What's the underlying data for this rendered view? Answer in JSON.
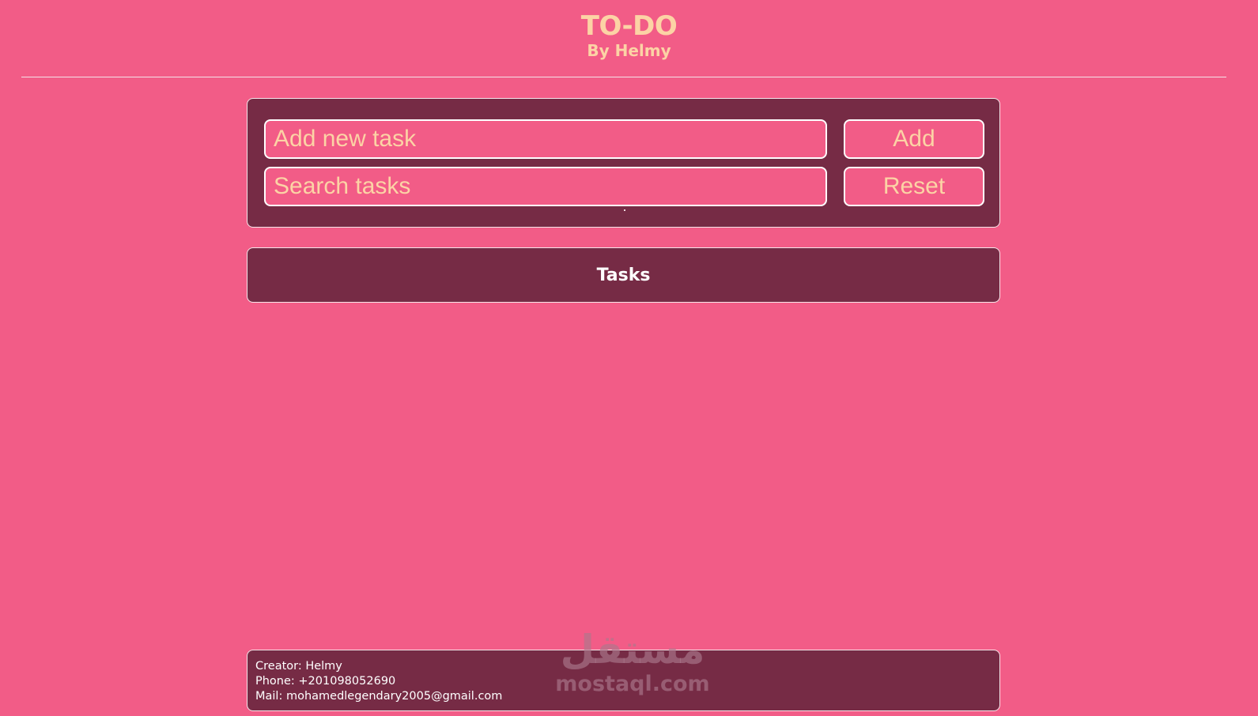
{
  "header": {
    "title": "TO-DO",
    "subtitle": "By Helmy"
  },
  "controls": {
    "new_task_placeholder": "Add new task",
    "new_task_value": "",
    "add_label": "Add",
    "search_placeholder": "Search tasks",
    "search_value": "",
    "reset_label": "Reset"
  },
  "tasks": {
    "heading": "Tasks",
    "items": []
  },
  "footer": {
    "creator": "Creator: Helmy",
    "phone": "Phone: +201098052690",
    "mail": "Mail: mohamedlegendary2005@gmail.com"
  },
  "watermark": {
    "arabic": "مستقل",
    "latin": "mostaql.com"
  },
  "colors": {
    "background": "#f25c87",
    "panel": "#762b45",
    "accent_text": "#fcd3a5",
    "border": "#ffffff"
  }
}
